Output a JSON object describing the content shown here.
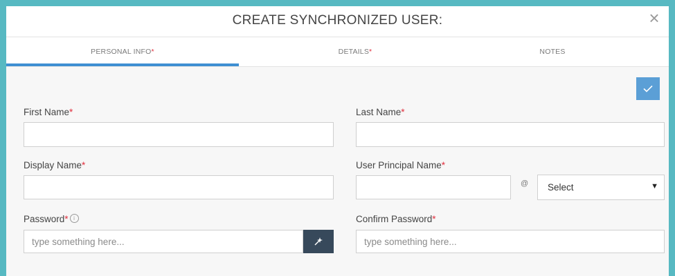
{
  "dialog": {
    "title": "CREATE SYNCHRONIZED USER:",
    "close_icon": "close-icon"
  },
  "tabs": [
    {
      "label": "PERSONAL INFO",
      "required": "*",
      "active": true
    },
    {
      "label": "DETAILS",
      "required": "*",
      "active": false
    },
    {
      "label": "NOTES",
      "required": "",
      "active": false
    }
  ],
  "submit": {
    "icon": "checkmark-icon"
  },
  "form": {
    "first_name": {
      "label": "First Name",
      "required": "*",
      "value": ""
    },
    "last_name": {
      "label": "Last Name",
      "required": "*",
      "value": ""
    },
    "display_name": {
      "label": "Display Name",
      "required": "*",
      "value": ""
    },
    "upn": {
      "label": "User Principal Name",
      "required": "*",
      "value": "",
      "at": "@",
      "domain_select": "Select",
      "select_arrow": "▼"
    },
    "password": {
      "label": "Password",
      "required": "*",
      "info_icon": "info-icon",
      "placeholder": "type something here...",
      "generate_icon": "magic-wand-icon"
    },
    "confirm_password": {
      "label": "Confirm Password",
      "required": "*",
      "placeholder": "type something here..."
    }
  },
  "colors": {
    "frame": "#57b9c2",
    "accent": "#3f8fd2",
    "submit": "#5b9fd6",
    "required": "#e0303e",
    "generate_button": "#37495b"
  }
}
